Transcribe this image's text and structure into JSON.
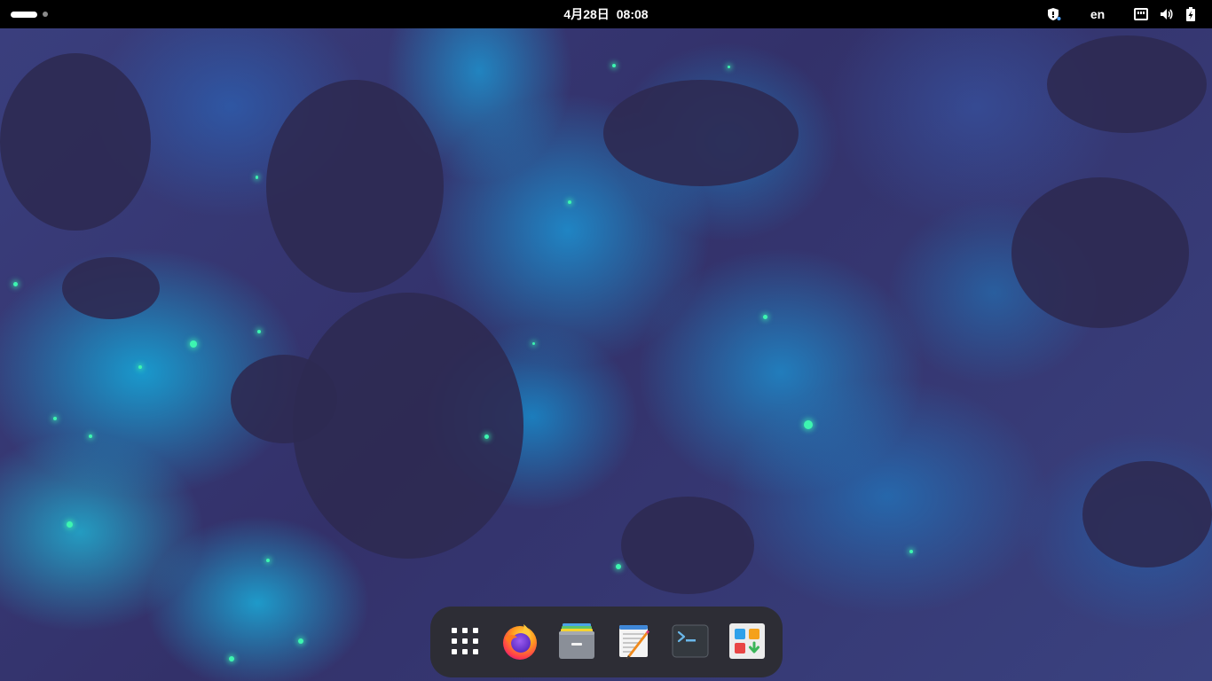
{
  "topbar": {
    "date": "4月28日",
    "time": "08:08",
    "language": "en",
    "workspace_count": 2,
    "active_workspace": 1
  },
  "tray_icons": [
    "privacy-shield-icon",
    "network-wired-icon",
    "volume-icon",
    "battery-charging-icon"
  ],
  "dock": {
    "items": [
      {
        "name": "show-apps",
        "icon": "app-grid-icon"
      },
      {
        "name": "firefox",
        "icon": "firefox-icon"
      },
      {
        "name": "files",
        "icon": "files-icon"
      },
      {
        "name": "text-editor",
        "icon": "text-editor-icon"
      },
      {
        "name": "terminal",
        "icon": "terminal-icon"
      },
      {
        "name": "software",
        "icon": "software-store-icon"
      }
    ]
  },
  "colors": {
    "topbar_bg": "#000000",
    "dock_bg": "#2d2d30",
    "wallpaper_dark": "#2e2a52",
    "wallpaper_blue": "#1aa6e0",
    "wallpaper_glow": "#3df5b0"
  }
}
